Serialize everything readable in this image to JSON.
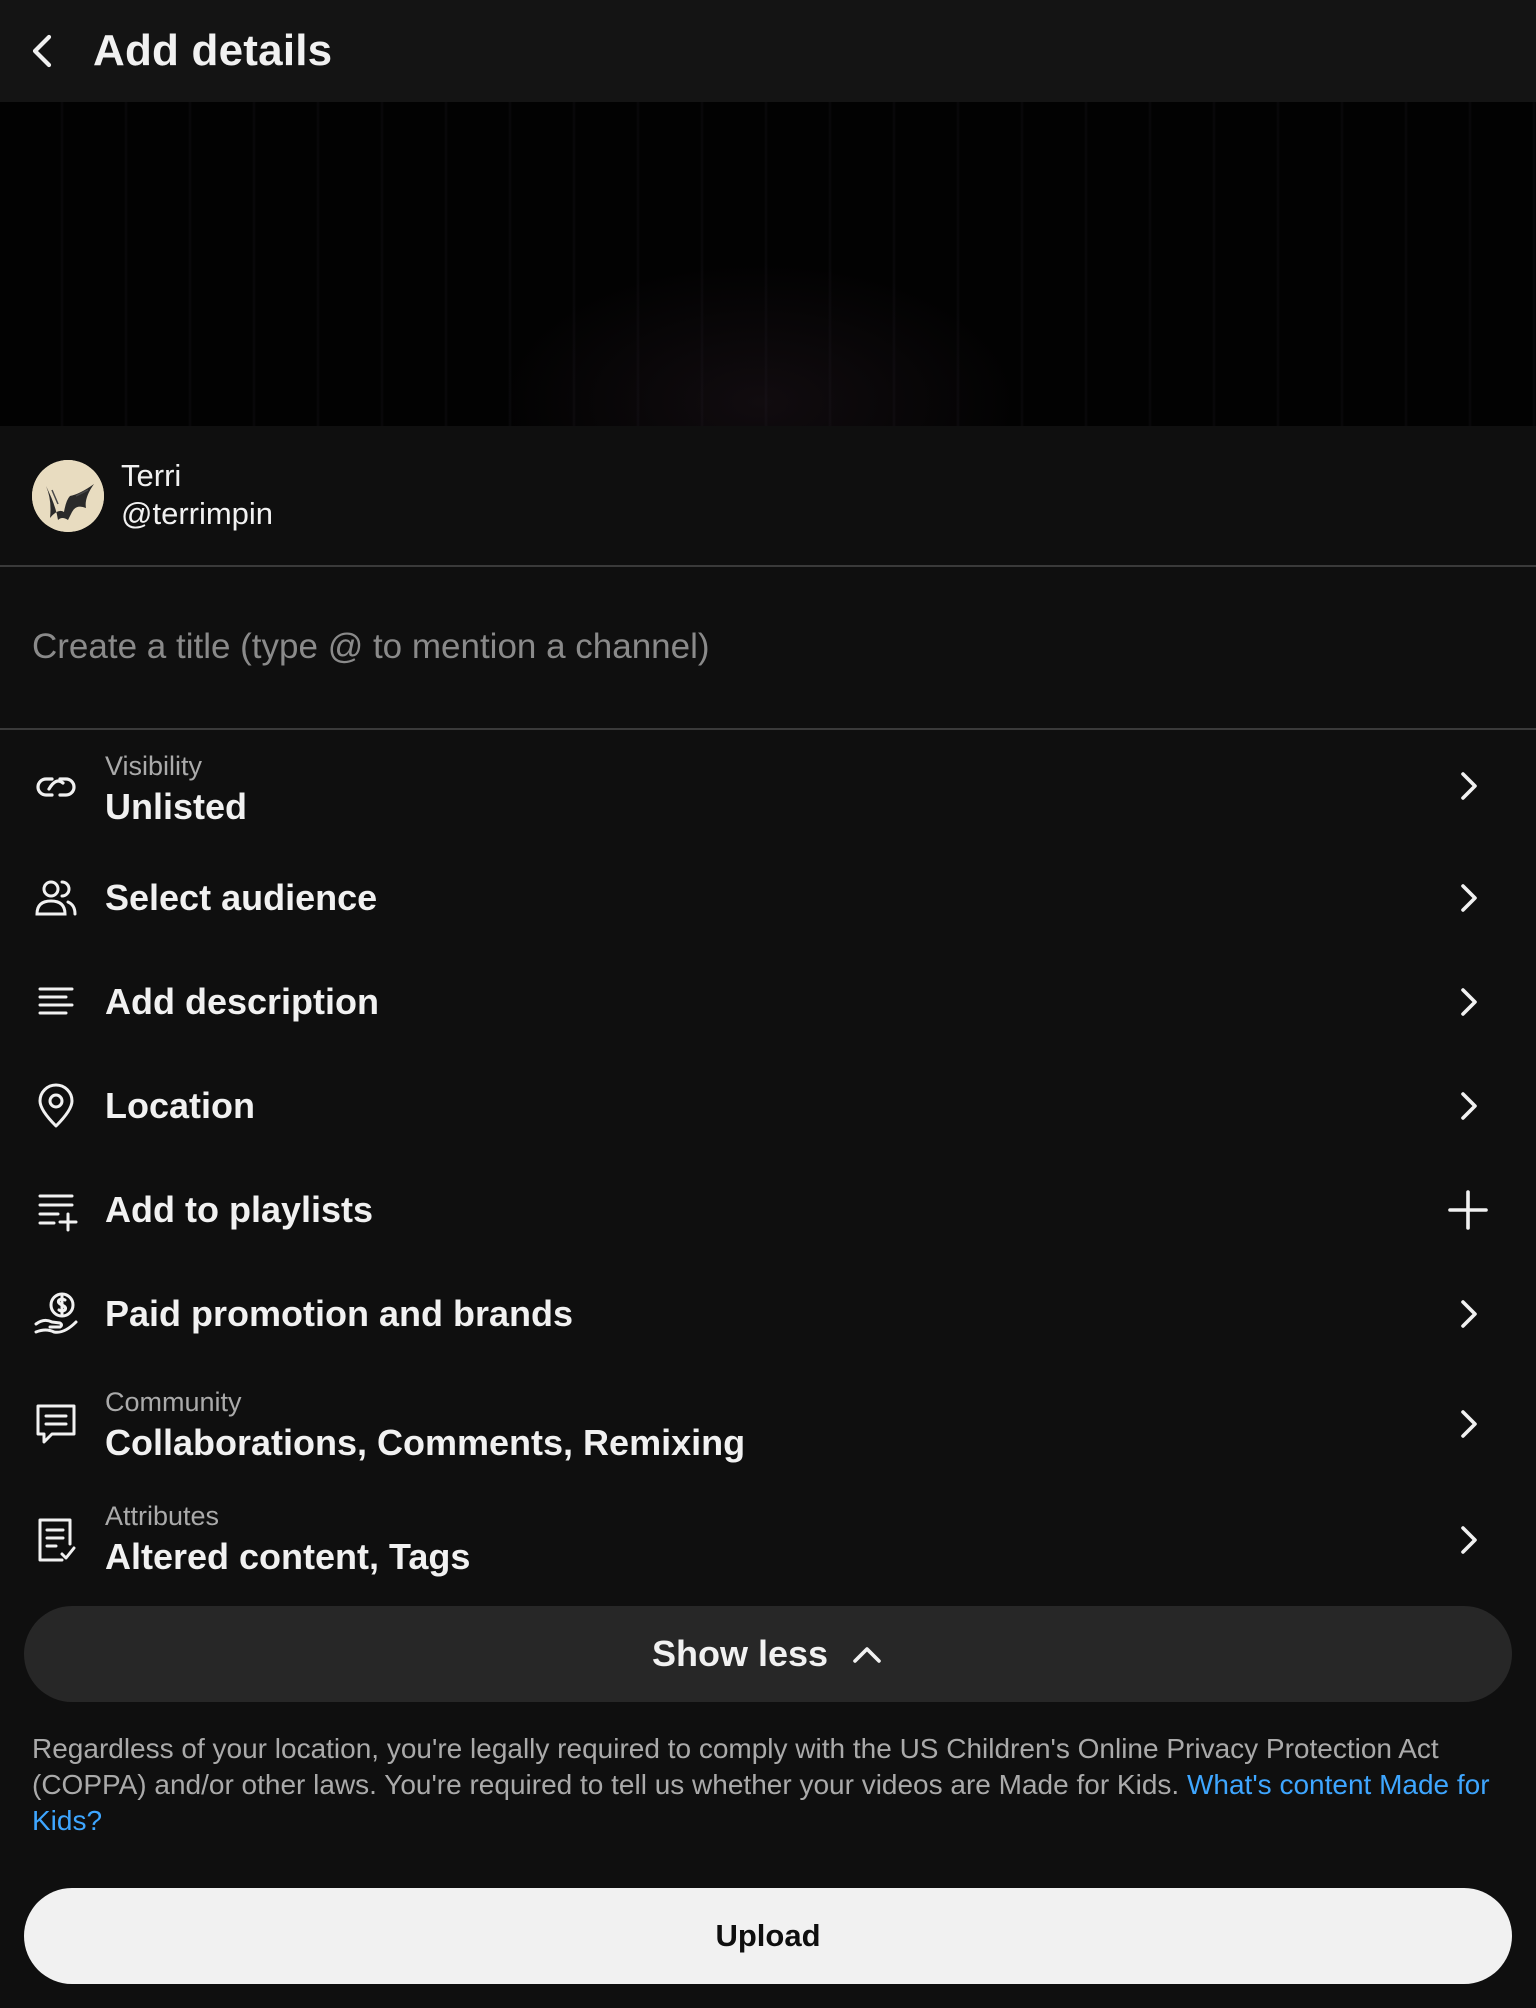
{
  "header": {
    "title": "Add details",
    "back_icon": "chevron-left-icon"
  },
  "channel": {
    "name": "Terri",
    "handle": "@terrimpin"
  },
  "title_input": {
    "placeholder": "Create a title (type @ to mention a channel)",
    "value": ""
  },
  "settings": {
    "visibility": {
      "sub": "Visibility",
      "label": "Unlisted",
      "icon": "link-icon"
    },
    "audience": {
      "label": "Select audience",
      "icon": "people-icon"
    },
    "description": {
      "label": "Add description",
      "icon": "lines-icon"
    },
    "location": {
      "label": "Location",
      "icon": "location-pin-icon"
    },
    "playlists": {
      "label": "Add to playlists",
      "icon": "playlist-add-icon",
      "action_icon": "plus-icon"
    },
    "paid_promotion": {
      "label": "Paid promotion and brands",
      "icon": "dollar-hand-icon"
    },
    "community": {
      "sub": "Community",
      "label": "Collaborations, Comments, Remixing",
      "icon": "comment-icon"
    },
    "attributes": {
      "sub": "Attributes",
      "label": "Altered content, Tags",
      "icon": "document-check-icon"
    }
  },
  "show_less": {
    "label": "Show less"
  },
  "disclaimer": {
    "text": "Regardless of your location, you're legally required to comply with the US Children's Online Privacy Protection Act (COPPA) and/or other laws. You're required to tell us whether your videos are Made for Kids. ",
    "link": "What's content Made for Kids?"
  },
  "upload": {
    "label": "Upload"
  },
  "colors": {
    "background": "#0f0f0f",
    "header": "#141414",
    "link": "#3ea6ff",
    "button_dark": "#272727",
    "button_light": "#f1f1f1"
  }
}
